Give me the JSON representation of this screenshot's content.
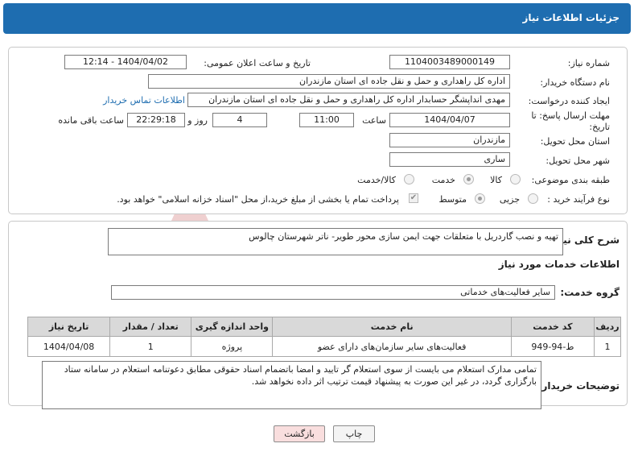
{
  "header": {
    "title": "جزئیات اطلاعات نیاز"
  },
  "form": {
    "need_number_label": "شماره نیاز:",
    "need_number_value": "1104003489000149",
    "announce_datetime_label": "تاریخ و ساعت اعلان عمومی:",
    "announce_datetime_value": "1404/04/02 - 12:14",
    "buyer_org_label": "نام دستگاه خریدار:",
    "buyer_org_value": "اداره کل راهداری و حمل و نقل جاده ای استان مازندران",
    "creator_label": "ایجاد کننده درخواست:",
    "creator_value": "مهدی انداپشگر حسابدار اداره کل راهداری و حمل و نقل جاده ای استان مازندران",
    "buyer_contact_link": "اطلاعات تماس خریدار",
    "deadline_label_1": "مهلت ارسال پاسخ: تا",
    "deadline_label_2": "تاریخ:",
    "deadline_date": "1404/04/07",
    "time_label": "ساعت",
    "deadline_time": "11:00",
    "days_value": "4",
    "days_label": "روز و",
    "remaining_time": "22:29:18",
    "remaining_label": "ساعت باقی مانده",
    "province_label": "استان محل تحویل:",
    "province_value": "مازندران",
    "city_label": "شهر محل تحویل:",
    "city_value": "ساری",
    "category_label": "طبقه بندی موضوعی:",
    "category_options": [
      "کالا",
      "خدمت",
      "کالا/خدمت"
    ],
    "category_selected": "خدمت",
    "process_label": "نوع فرآیند خرید :",
    "process_options": [
      "جزیی",
      "متوسط"
    ],
    "process_selected": "متوسط",
    "payment_note": "پرداخت تمام یا بخشی از مبلغ خرید،از محل \"اسناد خزانه اسلامی\" خواهد بود.",
    "payment_checked": true
  },
  "summary": {
    "label": "شرح کلی نیاز:",
    "value": "تهیه و نصب گاردریل با متعلقات جهت ایمن سازی محور طویر- ناتر شهرستان چالوس"
  },
  "services": {
    "section_title": "اطلاعات خدمات مورد نیاز",
    "group_label": "گروه خدمت:",
    "group_value": "سایر فعالیت‌های خدماتی",
    "columns": [
      "ردیف",
      "کد خدمت",
      "نام خدمت",
      "واحد اندازه گیری",
      "تعداد / مقدار",
      "تاریخ نیاز"
    ],
    "rows": [
      {
        "row": "1",
        "code": "ط-94-949",
        "name": "فعالیت‌های سایر سازمان‌های دارای عضو",
        "unit": "پروژه",
        "qty": "1",
        "date": "1404/04/08"
      }
    ]
  },
  "buyer_notes": {
    "label": "توضیحات خریدار:",
    "value": "تمامی مدارک استعلام می بایست از سوی استعلام گر تایید و امضا باتضمام اسناد حقوقی مطابق دعوتنامه استعلام در سامانه ستاد بارگزاری گردد، در غیر این صورت به پیشنهاد قیمت ترتیب اثر داده نخواهد شد."
  },
  "actions": {
    "print_label": "چاپ",
    "back_label": "بازگشت"
  },
  "watermark": {
    "text": "AriaTender.neT"
  },
  "colors": {
    "header_bg": "#1e6db0",
    "table_header_bg": "#d9d9d9",
    "back_button_bg": "#f9dede",
    "watermark": "#e7b7b7"
  }
}
